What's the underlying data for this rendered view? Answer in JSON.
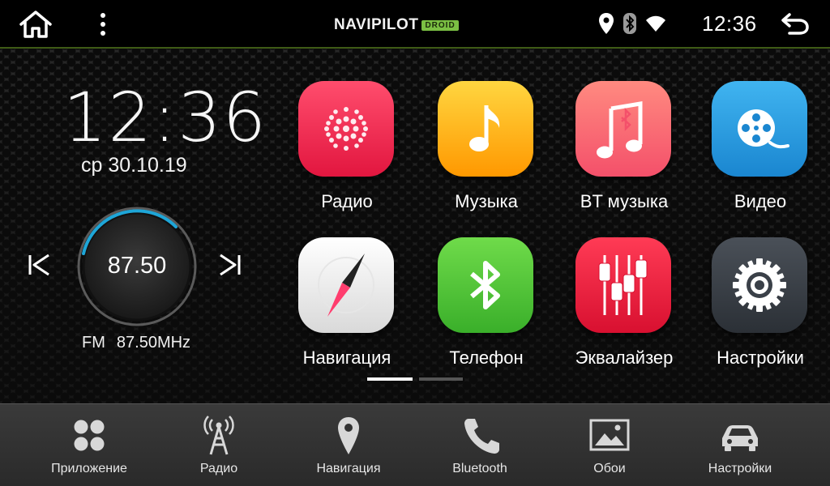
{
  "status_bar": {
    "brand": "NAVIPILOT",
    "brand_suffix": "DROID",
    "time": "12:36",
    "icons": [
      "location-icon",
      "bluetooth-icon",
      "wifi-icon"
    ]
  },
  "clock_widget": {
    "time": "12:36",
    "date": "ср 30.10.19"
  },
  "radio_widget": {
    "frequency": "87.50",
    "band": "FM",
    "frequency_mhz": "87.50MHz"
  },
  "apps": [
    {
      "label": "Радио",
      "icon": "radio-app-icon",
      "color": "#f0305a"
    },
    {
      "label": "Музыка",
      "icon": "music-app-icon",
      "color": "#ffb300"
    },
    {
      "label": "BT музыка",
      "icon": "bt-music-app-icon",
      "color": "#ff6f6f"
    },
    {
      "label": "Видео",
      "icon": "video-app-icon",
      "color": "#2b9de0"
    },
    {
      "label": "Навигация",
      "icon": "navigation-app-icon",
      "color": "#eeeeee"
    },
    {
      "label": "Телефон",
      "icon": "phone-app-icon",
      "color": "#4fc63a"
    },
    {
      "label": "Эквалайзер",
      "icon": "equalizer-app-icon",
      "color": "#e8203c"
    },
    {
      "label": "Настройки",
      "icon": "settings-app-icon",
      "color": "#3a4048"
    }
  ],
  "pager": {
    "pages": 2,
    "active": 0
  },
  "dock": [
    {
      "label": "Приложение",
      "icon": "apps-icon"
    },
    {
      "label": "Радио",
      "icon": "radio-tower-icon"
    },
    {
      "label": "Навигация",
      "icon": "map-pin-icon"
    },
    {
      "label": "Bluetooth",
      "icon": "phone-icon"
    },
    {
      "label": "Обои",
      "icon": "wallpaper-icon"
    },
    {
      "label": "Настройки",
      "icon": "car-icon"
    }
  ]
}
